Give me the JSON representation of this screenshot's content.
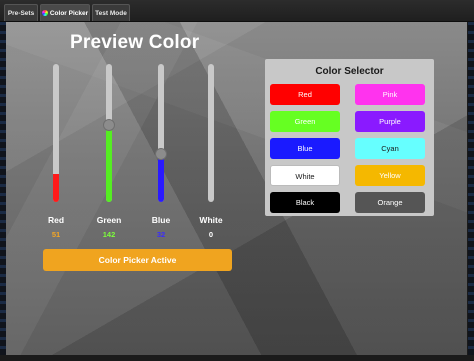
{
  "tabs": [
    {
      "label": "Pre-Sets",
      "active": false
    },
    {
      "label": "Color Picker",
      "active": true,
      "icon": "color-wheel-icon"
    },
    {
      "label": "Test Mode",
      "active": false
    }
  ],
  "preview": {
    "title": "Preview Color",
    "sliders": [
      {
        "name": "Red",
        "value": "51",
        "level": 0.2,
        "color": "#ff1a1a",
        "value_color": "#f5a623"
      },
      {
        "name": "Green",
        "value": "142",
        "level": 0.56,
        "color": "#55ee22",
        "value_color": "#7dff3a"
      },
      {
        "name": "Blue",
        "value": "32",
        "level": 0.35,
        "color": "#2a1aff",
        "value_color": "#3a2aff"
      },
      {
        "name": "White",
        "value": "0",
        "level": 0.0,
        "color": "#ffffff",
        "value_color": "#ffffff"
      }
    ],
    "status_button": "Color Picker Active"
  },
  "selector": {
    "title": "Color Selector",
    "buttons": [
      {
        "label": "Red",
        "bg": "#ff0000",
        "fg": "#ffffff"
      },
      {
        "label": "Pink",
        "bg": "#ff33ee",
        "fg": "#ffffff"
      },
      {
        "label": "Green",
        "bg": "#66ff22",
        "fg": "#ffffff"
      },
      {
        "label": "Purple",
        "bg": "#8a1aff",
        "fg": "#ffffff"
      },
      {
        "label": "Blue",
        "bg": "#1a1aff",
        "fg": "#ffffff"
      },
      {
        "label": "Cyan",
        "bg": "#66ffff",
        "fg": "#1a1a1a"
      },
      {
        "label": "White",
        "bg": "#ffffff",
        "fg": "#1a1a1a"
      },
      {
        "label": "Yellow",
        "bg": "#f5b800",
        "fg": "#ffffff"
      },
      {
        "label": "Black",
        "bg": "#000000",
        "fg": "#ffffff"
      },
      {
        "label": "Orange",
        "bg": "#555555",
        "fg": "#ffffff"
      }
    ]
  }
}
